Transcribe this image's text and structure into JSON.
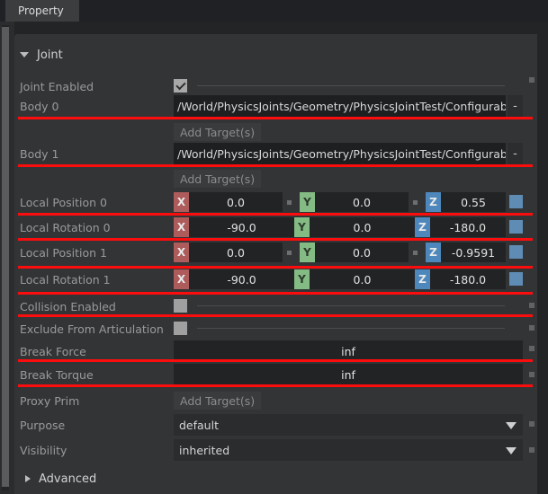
{
  "window": {
    "tab_label": "Property"
  },
  "section": {
    "joint_label": "Joint",
    "advanced_label": "Advanced"
  },
  "properties": {
    "joint_enabled": {
      "label": "Joint Enabled",
      "checked": true
    },
    "body0": {
      "label": "Body 0",
      "path": "/World/PhysicsJoints/Geometry/PhysicsJointTest/ConfigurableJoin",
      "minus_label": "-",
      "add_target_label": "Add Target(s)"
    },
    "body1": {
      "label": "Body 1",
      "path": "/World/PhysicsJoints/Geometry/PhysicsJointTest/ConfigurableJoin",
      "minus_label": "-",
      "add_target_label": "Add Target(s)"
    },
    "local_position_0": {
      "label": "Local Position 0",
      "x_axis": "X",
      "y_axis": "Y",
      "z_axis": "Z",
      "x": "0.0",
      "y": "0.0",
      "z": "0.55"
    },
    "local_rotation_0": {
      "label": "Local Rotation 0",
      "x_axis": "X",
      "y_axis": "Y",
      "z_axis": "Z",
      "x": "-90.0",
      "y": "0.0",
      "z": "-180.0"
    },
    "local_position_1": {
      "label": "Local Position 1",
      "x_axis": "X",
      "y_axis": "Y",
      "z_axis": "Z",
      "x": "0.0",
      "y": "0.0",
      "z": "-0.9591"
    },
    "local_rotation_1": {
      "label": "Local Rotation 1",
      "x_axis": "X",
      "y_axis": "Y",
      "z_axis": "Z",
      "x": "-90.0",
      "y": "0.0",
      "z": "-180.0"
    },
    "collision_enabled": {
      "label": "Collision Enabled",
      "checked": false
    },
    "exclude_from_articulation": {
      "label": "Exclude From Articulation",
      "checked": false
    },
    "break_force": {
      "label": "Break Force",
      "value": "inf"
    },
    "break_torque": {
      "label": "Break Torque",
      "value": "inf"
    },
    "proxy_prim": {
      "label": "Proxy Prim",
      "add_target_label": "Add Target(s)"
    },
    "purpose": {
      "label": "Purpose",
      "value": "default"
    },
    "visibility": {
      "label": "Visibility",
      "value": "inherited"
    }
  },
  "colors": {
    "axis_x": "#ad5b5b",
    "axis_y": "#84bb84",
    "axis_z": "#4d87bb",
    "annotation_red": "#fc0d0d",
    "panel_bg": "#333436",
    "field_bg": "#222325"
  }
}
